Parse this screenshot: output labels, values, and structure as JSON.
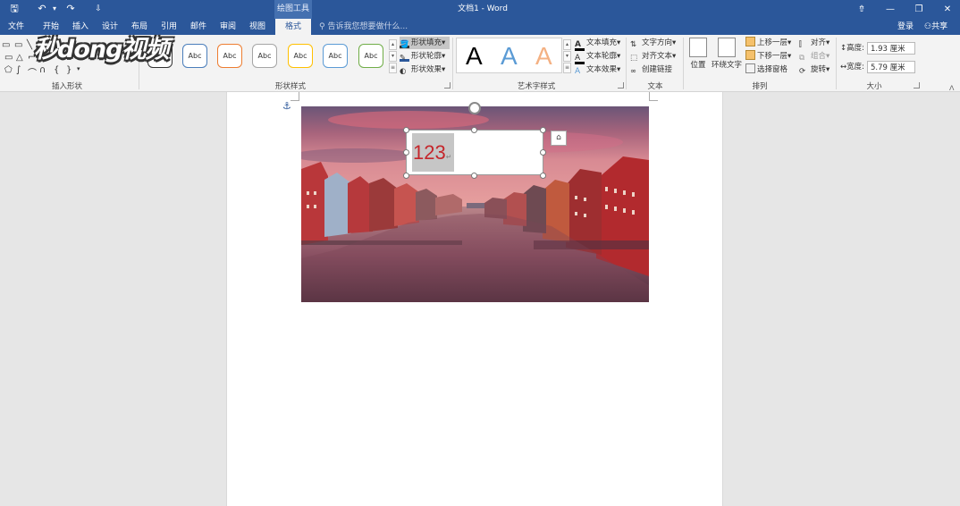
{
  "window": {
    "context_tab_group": "绘图工具",
    "doc_title": "文档1 - Word",
    "qa_save": "🖫",
    "qa_undo": "↶",
    "qa_undo_drop": "▾",
    "qa_redo": "↷",
    "qa_more": "⇩",
    "btn_ribbon": "⇮",
    "btn_min": "—",
    "btn_restore": "❐",
    "btn_close": "✕"
  },
  "tabs": [
    {
      "label": "文件"
    },
    {
      "label": "开始"
    },
    {
      "label": "插入"
    },
    {
      "label": "设计"
    },
    {
      "label": "布局"
    },
    {
      "label": "引用"
    },
    {
      "label": "邮件"
    },
    {
      "label": "审阅"
    },
    {
      "label": "视图"
    },
    {
      "label": "格式"
    }
  ],
  "tell_me": "告诉我您想要做什么...",
  "login": "登录",
  "share": "共享",
  "groups": {
    "insert_shapes": "插入形状",
    "shape_styles": "形状样式",
    "wordart_styles": "艺术字样式",
    "text": "文本",
    "arrange": "排列",
    "size": "大小"
  },
  "shape_styles": [
    "Abc",
    "Abc",
    "Abc",
    "Abc",
    "Abc",
    "Abc",
    "Abc"
  ],
  "shape_style_colors": [
    "#333333",
    "#4a7ebb",
    "#ed7d31",
    "#a5a5a5",
    "#ffc000",
    "#5b9bd5",
    "#70ad47"
  ],
  "shape_buttons": {
    "fill": "形状填充",
    "outline": "形状轮廓",
    "effects": "形状效果"
  },
  "wordart_letters": [
    "A",
    "A",
    "A"
  ],
  "wordart_colors": [
    "#000000",
    "#5b9bd5",
    "#f4b183"
  ],
  "text_buttons": {
    "fill": "文本填充",
    "outline": "文本轮廓",
    "effects": "文本效果"
  },
  "text_group": {
    "direction": "文字方向",
    "align": "对齐文本",
    "link": "创建链接"
  },
  "arrange": {
    "position": "位置",
    "wrap": "环绕文字",
    "forward": "上移一层",
    "backward": "下移一层",
    "selection_pane": "选择窗格",
    "align": "对齐",
    "group": "组合",
    "rotate": "旋转"
  },
  "size": {
    "height_label": "高度:",
    "height_value": "1.93 厘米",
    "width_label": "宽度:",
    "width_value": "5.79 厘米"
  },
  "textbox_text": "123",
  "watermark": "秒dong视频"
}
